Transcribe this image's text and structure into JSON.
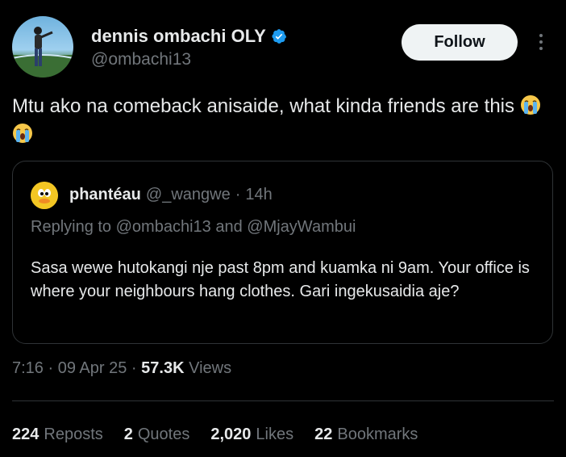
{
  "author": {
    "name": "dennis ombachi OLY",
    "handle": "@ombachi13",
    "verified_color": "#1d9bf0"
  },
  "follow_label": "Follow",
  "tweet": {
    "text": "Mtu ako na comeback anisaide, what kinda friends are this",
    "emojis": [
      "loudly-crying-face",
      "loudly-crying-face"
    ]
  },
  "quoted": {
    "name": "phantéau",
    "handle": "@_wangwe",
    "separator": "·",
    "time": "14h",
    "reply_prefix": "Replying to",
    "reply_user1": "@ombachi13",
    "reply_and": "and",
    "reply_user2": "@MjayWambui",
    "text": "Sasa wewe hutokangi nje past 8pm and kuamka ni 9am. Your office is where your neighbours hang clothes. Gari ingekusaidia aje?"
  },
  "meta": {
    "time": "7:16",
    "separator": "·",
    "date": "09 Apr 25",
    "views_count": "57.3K",
    "views_label": "Views"
  },
  "stats": {
    "reposts_count": "224",
    "reposts_label": "Reposts",
    "quotes_count": "2",
    "quotes_label": "Quotes",
    "likes_count": "2,020",
    "likes_label": "Likes",
    "bookmarks_count": "22",
    "bookmarks_label": "Bookmarks"
  }
}
